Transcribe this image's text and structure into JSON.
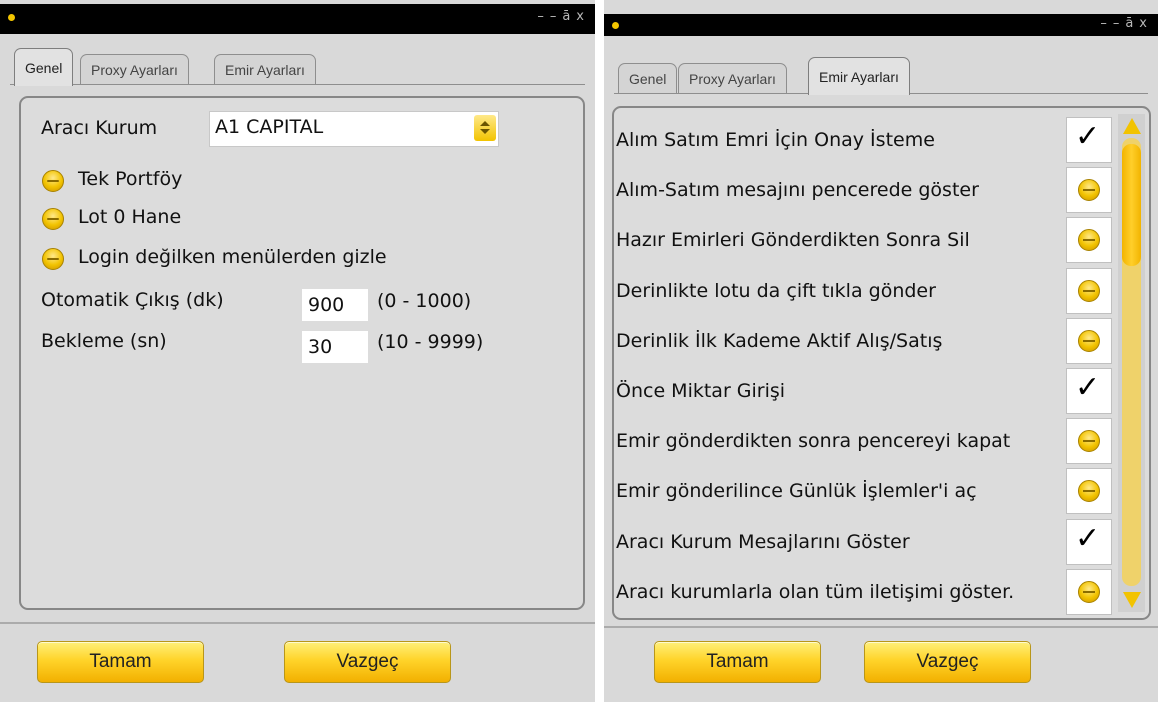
{
  "titlebar": {
    "controls": [
      "–",
      "–",
      "ā",
      "x"
    ]
  },
  "tabs": {
    "genel": "Genel",
    "proxy": "Proxy Ayarları",
    "emir": "Emir Ayarları"
  },
  "genel": {
    "araci_kurum_label": "Aracı Kurum",
    "araci_kurum_value": "A1 CAPITAL",
    "options": [
      {
        "label": "Tek Portföy",
        "checked": false
      },
      {
        "label": "Lot 0 Hane",
        "checked": false
      },
      {
        "label": "Login değilken menülerden gizle",
        "checked": false
      }
    ],
    "otomatik_cikis": {
      "label": "Otomatik Çıkış (dk)",
      "value": "900",
      "range": "(0 - 1000)"
    },
    "bekleme": {
      "label": "Bekleme (sn)",
      "value": "30",
      "range": "(10 - 9999)"
    }
  },
  "emir": {
    "rows": [
      {
        "label": "Alım Satım Emri İçin Onay İsteme",
        "checked": true
      },
      {
        "label": "Alım-Satım mesajını pencerede göster",
        "checked": false
      },
      {
        "label": "Hazır Emirleri Gönderdikten Sonra Sil",
        "checked": false
      },
      {
        "label": "Derinlikte lotu da çift tıkla gönder",
        "checked": false
      },
      {
        "label": "Derinlik İlk Kademe Aktif Alış/Satış",
        "checked": false
      },
      {
        "label": "Önce Miktar Girişi",
        "checked": true
      },
      {
        "label": "Emir gönderdikten sonra pencereyi kapat",
        "checked": false
      },
      {
        "label": "Emir gönderilince Günlük İşlemler'i aç",
        "checked": false
      },
      {
        "label": "Aracı Kurum Mesajlarını Göster",
        "checked": true
      },
      {
        "label": "Aracı kurumlarla olan tüm iletişimi göster.",
        "checked": false
      }
    ],
    "check_glyph": "✓"
  },
  "buttons": {
    "ok": "Tamam",
    "cancel": "Vazgeç"
  }
}
